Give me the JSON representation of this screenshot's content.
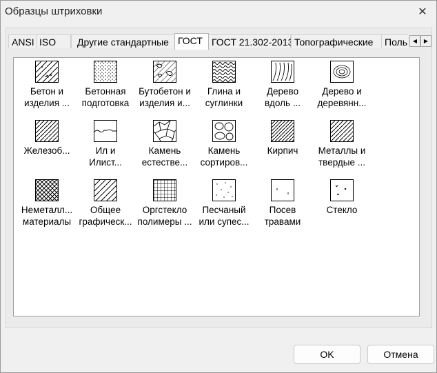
{
  "window": {
    "title": "Образцы штриховки"
  },
  "tabs": [
    {
      "label": "ANSI"
    },
    {
      "label": "ISO"
    },
    {
      "label": "Другие стандартные"
    },
    {
      "label": "ГОСТ",
      "active": true
    },
    {
      "label": "ГОСТ 21.302-2013"
    },
    {
      "label": "Топографические"
    },
    {
      "label": "Поль"
    }
  ],
  "patterns": [
    {
      "line1": "Бетон и",
      "line2": "изделия ...",
      "pattern": "concrete-pattern"
    },
    {
      "line1": "Бетонная",
      "line2": "подготовка",
      "pattern": "concrete-prep-pattern"
    },
    {
      "line1": "Бутобетон и",
      "line2": "изделия и...",
      "pattern": "rubble-concrete-pattern"
    },
    {
      "line1": "Глина и",
      "line2": "суглинки",
      "pattern": "clay-pattern"
    },
    {
      "line1": "Дерево",
      "line2": "вдоль ...",
      "pattern": "wood-along-pattern"
    },
    {
      "line1": "Дерево и",
      "line2": "деревянн...",
      "pattern": "wood-pattern"
    },
    {
      "line1": "Железоб...",
      "line2": "",
      "pattern": "reinforced-concrete-pattern"
    },
    {
      "line1": "Ил и",
      "line2": "Илист...",
      "pattern": "silt-pattern"
    },
    {
      "line1": "Камень",
      "line2": "естестве...",
      "pattern": "natural-stone-pattern"
    },
    {
      "line1": "Камень",
      "line2": "сортиров...",
      "pattern": "sorted-stone-pattern"
    },
    {
      "line1": "Кирпич",
      "line2": "",
      "pattern": "brick-pattern"
    },
    {
      "line1": "Металлы и",
      "line2": "твердые ...",
      "pattern": "metal-pattern"
    },
    {
      "line1": "Неметалл...",
      "line2": "материалы",
      "pattern": "nonmetal-pattern"
    },
    {
      "line1": "Общее",
      "line2": "графическ...",
      "pattern": "general-pattern"
    },
    {
      "line1": "Оргстекло",
      "line2": "полимеры ...",
      "pattern": "plexiglass-pattern"
    },
    {
      "line1": "Песчаный",
      "line2": "или супес...",
      "pattern": "sand-pattern"
    },
    {
      "line1": "Посев",
      "line2": "травами",
      "pattern": "grass-pattern"
    },
    {
      "line1": "Стекло",
      "line2": "",
      "pattern": "glass-pattern"
    }
  ],
  "buttons": {
    "ok": "OK",
    "cancel": "Отмена"
  }
}
